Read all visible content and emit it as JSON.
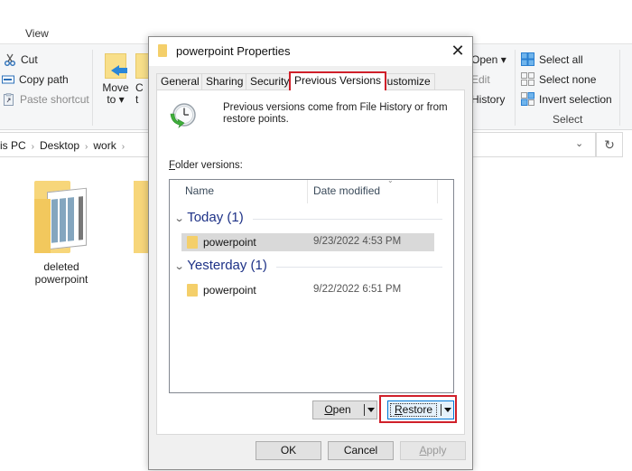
{
  "explorer": {
    "ribbon_tab": "View",
    "clipboard": {
      "cut": "Cut",
      "copy_path": "Copy path",
      "paste_shortcut": "Paste shortcut"
    },
    "organize": {
      "move_to_line1": "Move",
      "move_to_line2": "to ▾",
      "copy_to_partial_line1": "C",
      "copy_to_partial_line2": "t"
    },
    "open": {
      "open": "Open ▾",
      "edit": "Edit",
      "history": "History"
    },
    "select": {
      "select_all": "Select all",
      "select_none": "Select none",
      "invert_selection": "Invert selection",
      "group_label": "Select"
    },
    "address": {
      "crumbs": [
        "is PC",
        "Desktop",
        "work"
      ],
      "separator": "›",
      "dropdown_icon": "⌄",
      "refresh_icon": "↻"
    },
    "files": [
      {
        "line1": "deleted",
        "line2": "powerpoint"
      }
    ]
  },
  "dialog": {
    "title": "powerpoint Properties",
    "close_icon": "✕",
    "tabs": [
      {
        "label": "General",
        "active": false
      },
      {
        "label": "Sharing",
        "active": false
      },
      {
        "label": "Security",
        "active": false
      },
      {
        "label": "Previous Versions",
        "active": true
      },
      {
        "label": "Customize",
        "active": false
      }
    ],
    "intro_text": "Previous versions come from File History or from restore points.",
    "folder_versions_label_first": "F",
    "folder_versions_label_rest": "older versions:",
    "columns": {
      "name": "Name",
      "date_modified": "Date modified"
    },
    "groups": [
      {
        "label": "Today (1)",
        "items": [
          {
            "name": "powerpoint",
            "date": "9/23/2022 4:53 PM",
            "selected": true
          }
        ]
      },
      {
        "label": "Yesterday (1)",
        "items": [
          {
            "name": "powerpoint",
            "date": "9/22/2022 6:51 PM",
            "selected": false
          }
        ]
      }
    ],
    "open_button": {
      "first": "O",
      "rest": "pen"
    },
    "restore_button": {
      "first": "R",
      "rest": "estore"
    },
    "ok_label": "OK",
    "cancel_label": "Cancel",
    "apply_button": {
      "first": "A",
      "rest": "pply"
    },
    "highlight_color": "#d0202a"
  }
}
